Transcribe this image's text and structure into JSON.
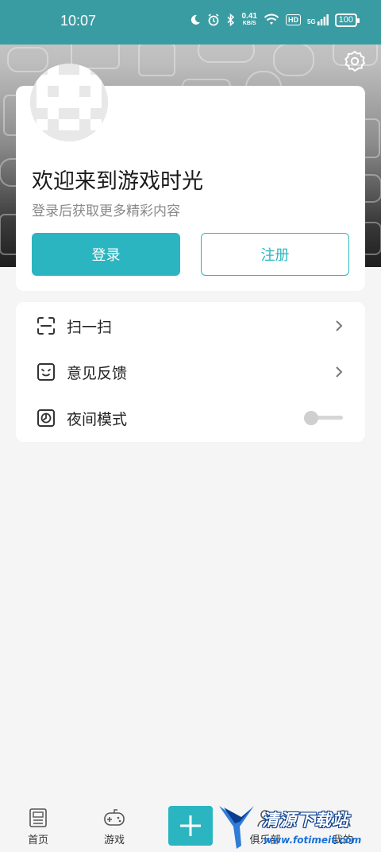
{
  "status_bar": {
    "time": "10:07",
    "speed_value": "0.41",
    "speed_unit": "KB/S",
    "hd": "HD",
    "signal": "5G",
    "battery": "100"
  },
  "profile": {
    "title": "欢迎来到游戏时光",
    "subtitle": "登录后获取更多精彩内容",
    "login_label": "登录",
    "register_label": "注册"
  },
  "menu": {
    "items": [
      {
        "label": "扫一扫",
        "icon": "scan-icon",
        "control": "chevron"
      },
      {
        "label": "意见反馈",
        "icon": "feedback-icon",
        "control": "chevron"
      },
      {
        "label": "夜间模式",
        "icon": "night-mode-icon",
        "control": "toggle",
        "toggle_on": false
      }
    ]
  },
  "bottom_nav": {
    "items": [
      {
        "label": "首页",
        "icon": "news-icon"
      },
      {
        "label": "游戏",
        "icon": "gamepad-icon"
      },
      {
        "label": "俱乐部",
        "icon": "club-icon"
      },
      {
        "label": "我的",
        "icon": "profile-icon"
      }
    ],
    "add_icon": "plus-icon"
  },
  "watermark": {
    "text": "清源下载站",
    "url": "www.fotimeit.com"
  },
  "colors": {
    "accent": "#2bb5c0",
    "status_bar": "#3a9ca3",
    "background": "#f5f5f5"
  }
}
